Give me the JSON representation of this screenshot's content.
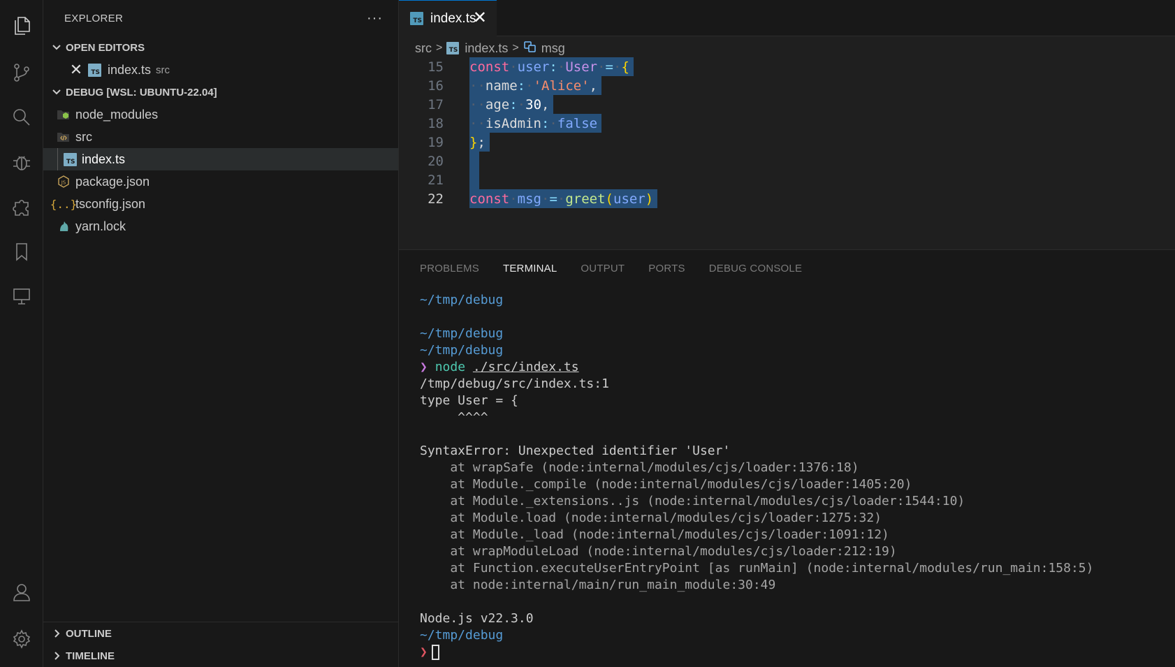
{
  "explorer": {
    "title": "EXPLORER",
    "more": "···",
    "open_editors": {
      "label": "OPEN EDITORS",
      "items": [
        {
          "name": "index.ts",
          "folder": "src"
        }
      ]
    },
    "workspace": {
      "label": "DEBUG [WSL: UBUNTU-22.04]",
      "items": [
        {
          "name": "node_modules",
          "icon": "node-folder-icon"
        },
        {
          "name": "src",
          "icon": "code-folder-icon"
        },
        {
          "name": "index.ts",
          "icon": "typescript-file-icon"
        },
        {
          "name": "package.json",
          "icon": "nodejs-file-icon"
        },
        {
          "name": "tsconfig.json",
          "icon": "json-braces-icon"
        },
        {
          "name": "yarn.lock",
          "icon": "yarn-cat-icon"
        }
      ]
    },
    "outline": "OUTLINE",
    "timeline": "TIMELINE"
  },
  "tab": {
    "name": "index.ts",
    "close": "✕",
    "badge": "TS"
  },
  "breadcrumb": {
    "folder": "src",
    "file": "index.ts",
    "symbol": "msg"
  },
  "code": {
    "line_numbers": [
      "15",
      "16",
      "17",
      "18",
      "19",
      "20",
      "21",
      "22"
    ],
    "l15": {
      "kw": "const",
      "id": "user",
      "colon": ":",
      "ty": "User",
      "eq": "=",
      "br": "{"
    },
    "l16": {
      "key": "name",
      "colon": ":",
      "val": "'Alice'",
      "comma": ","
    },
    "l17": {
      "key": "age",
      "colon": ":",
      "val": "30",
      "comma": ","
    },
    "l18": {
      "key": "isAdmin",
      "colon": ":",
      "val": "false"
    },
    "l19": {
      "br": "}",
      "semi": ";"
    },
    "l22": {
      "kw": "const",
      "id": "msg",
      "eq": "=",
      "fn": "greet",
      "open": "(",
      "arg": "user",
      "close": ")"
    }
  },
  "panel": {
    "tabs": [
      "PROBLEMS",
      "TERMINAL",
      "OUTPUT",
      "PORTS",
      "DEBUG CONSOLE"
    ],
    "active_tab": "TERMINAL"
  },
  "terminal": {
    "path": "~/tmp/debug",
    "prompt": "❯",
    "cmd": "node",
    "arg": "./src/index.ts",
    "err_loc": "/tmp/debug/src/index.ts:1",
    "err_src": "type User = {",
    "err_caret": "     ^^^^",
    "err_msg": "SyntaxError: Unexpected identifier 'User'",
    "trace": [
      "    at wrapSafe (node:internal/modules/cjs/loader:1376:18)",
      "    at Module._compile (node:internal/modules/cjs/loader:1405:20)",
      "    at Module._extensions..js (node:internal/modules/cjs/loader:1544:10)",
      "    at Module.load (node:internal/modules/cjs/loader:1275:32)",
      "    at Module._load (node:internal/modules/cjs/loader:1091:12)",
      "    at wrapModuleLoad (node:internal/modules/cjs/loader:212:19)",
      "    at Function.executeUserEntryPoint [as runMain] (node:internal/modules/run_main:158:5)",
      "    at node:internal/main/run_main_module:30:49"
    ],
    "node_version": "Node.js v22.3.0"
  }
}
